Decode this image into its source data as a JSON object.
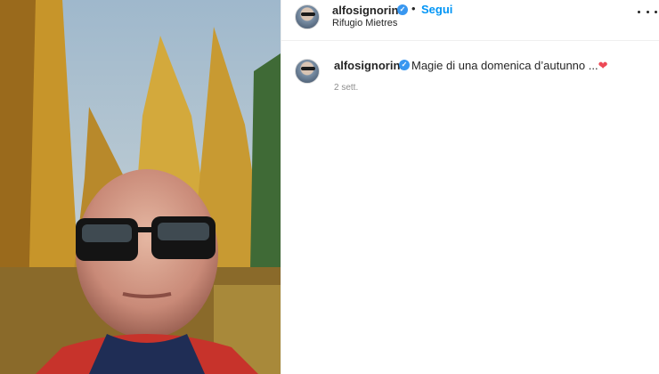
{
  "post": {
    "username": "alfosignorini",
    "verified_mark": "✓",
    "separator": "•",
    "follow_label": "Segui",
    "location": "Rifugio Mietres",
    "more_icon": "more-horizontal-icon",
    "media_description_icon": "photo",
    "caption": {
      "username": "alfosignorini",
      "text": "Magie di una domenica d’autunno ...",
      "emoji": "❤",
      "time": "2 sett."
    },
    "colors": {
      "accent": "#0095f6",
      "verified": "#3897f0",
      "heart": "#ed4956",
      "muted": "#8e8e8e"
    }
  }
}
